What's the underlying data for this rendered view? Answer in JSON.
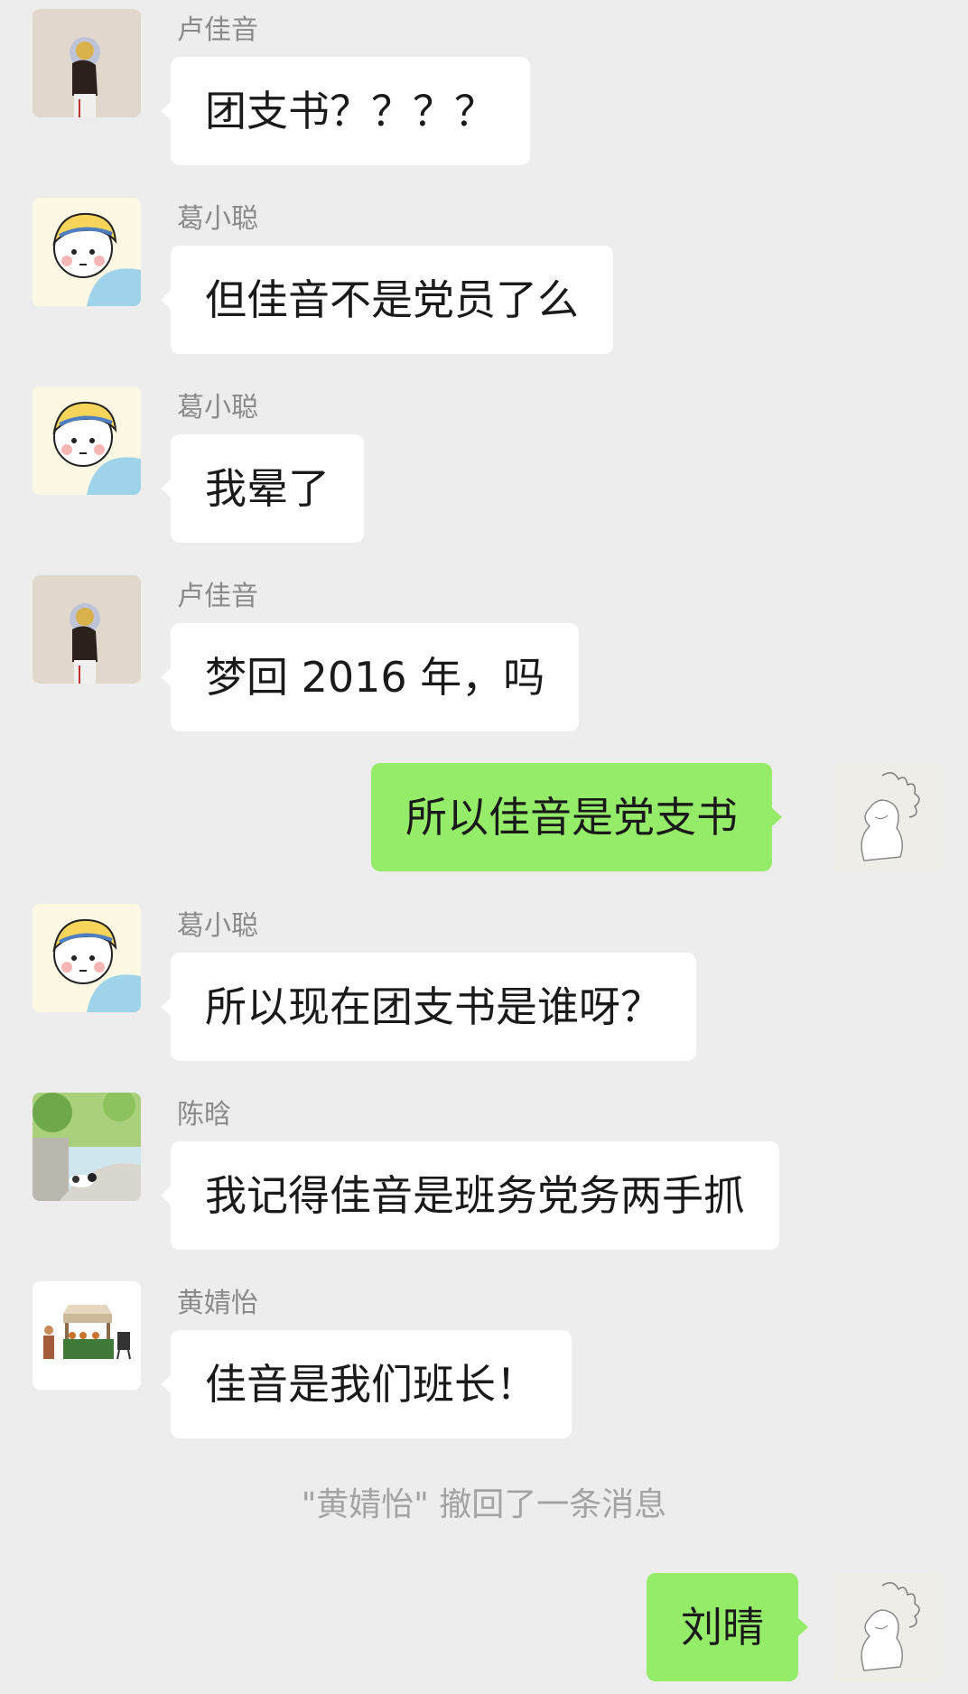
{
  "messages": [
    {
      "sender": "卢佳音",
      "text": "团支书？？？？",
      "avatar": "lu-jiayin-avatar"
    },
    {
      "sender": "葛小聪",
      "text": "但佳音不是党员了么",
      "avatar": "ge-xiaocong-avatar"
    },
    {
      "sender": "葛小聪",
      "text": "我晕了",
      "avatar": "ge-xiaocong-avatar"
    },
    {
      "sender": "卢佳音",
      "text": "梦回 2016 年，吗",
      "avatar": "lu-jiayin-avatar"
    },
    {
      "sender": "",
      "text": "所以佳音是党支书",
      "avatar": "self-avatar",
      "outgoing": true
    },
    {
      "sender": "葛小聪",
      "text": "所以现在团支书是谁呀？",
      "avatar": "ge-xiaocong-avatar"
    },
    {
      "sender": "陈晗",
      "text": "我记得佳音是班务党务两手抓",
      "avatar": "chen-han-avatar"
    },
    {
      "sender": "黄婧怡",
      "text": "佳音是我们班长！",
      "avatar": "huang-jingyi-avatar"
    },
    {
      "sender": "",
      "text": "刘晴",
      "avatar": "self-avatar",
      "outgoing": true
    }
  ],
  "system_note": "\"黄婧怡\" 撤回了一条消息",
  "colors": {
    "background": "#ededed",
    "incoming_bubble": "#ffffff",
    "outgoing_bubble": "#95ec69",
    "sender_name": "#8a8a8a",
    "system_text": "#a3a3a3"
  }
}
